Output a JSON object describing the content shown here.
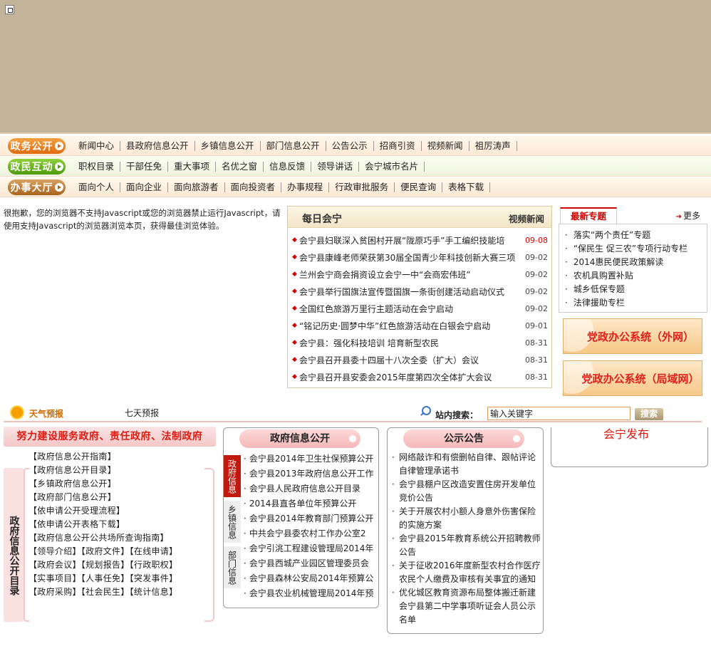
{
  "nav": [
    {
      "badge": "政务公开",
      "links": [
        "新闻中心",
        "县政府信息公开",
        "乡镇信息公开",
        "部门信息公开",
        "公告公示",
        "招商引资",
        "视频新闻",
        "祖厉涛声"
      ]
    },
    {
      "badge": "政民互动",
      "links": [
        "职权目录",
        "干部任免",
        "重大事项",
        "名优之窗",
        "信息反馈",
        "领导讲话",
        "会宁城市名片"
      ]
    },
    {
      "badge": "办事大厅",
      "links": [
        "面向个人",
        "面向企业",
        "面向旅游者",
        "面向投资者",
        "办事规程",
        "行政审批服务",
        "便民查询",
        "表格下载"
      ]
    }
  ],
  "noscript_message": "很抱歉，您的浏览器不支持Javascript或您的浏览器禁止运行Javascript，请使用支持Javascript的浏览器浏览本页，获得最佳浏览体验。",
  "news": {
    "title": "每日会宁",
    "video_label": "视频新闻",
    "items": [
      {
        "title": "会宁县妇联深入贫困村开展“陇原巧手”手工编织技能培",
        "date": "09-08"
      },
      {
        "title": "会宁县康峰老师荣获第30届全国青少年科技创新大赛三项",
        "date": "09-02"
      },
      {
        "title": "兰州会宁商会捐资设立会宁一中“会商宏伟班”",
        "date": "09-02"
      },
      {
        "title": "会宁县举行国旗法宣传暨国旗一条街创建活动启动仪式",
        "date": "09-02"
      },
      {
        "title": "全国红色旅游万里行主题活动在会宁启动",
        "date": "09-02"
      },
      {
        "title": "“铭记历史·圆梦中华”红色旅游活动在白银会宁启动",
        "date": "09-01"
      },
      {
        "title": "会宁县：强化科技培训  培育新型农民",
        "date": "08-31"
      },
      {
        "title": "会宁县召开县委十四届十八次全委（扩大）会议",
        "date": "08-31"
      },
      {
        "title": "会宁县召开县安委会2015年度第四次全体扩大会议",
        "date": "08-31"
      }
    ]
  },
  "special": {
    "tab": "最新专题",
    "more": "更多",
    "items": [
      "落实“两个责任”专题",
      "“保民生 促三农”专项行动专栏",
      "2014惠民便民政策解读",
      "农机具购置补贴",
      "城乡低保专题",
      "法律援助专栏"
    ]
  },
  "office_buttons": {
    "extranet": "党政办公系统（外网）",
    "intranet": "党政办公系统（局域网）"
  },
  "weather": {
    "label": "天气预报",
    "forecast": "七天预报"
  },
  "search": {
    "label": "站内搜索：",
    "value": "输入关键字",
    "button": "搜索"
  },
  "service": {
    "slogan": "努力建设服务政府、责任政府、法制政府",
    "catalog_label": "政府信息公开目录",
    "catalog_items": [
      "【政府信息公开指南】",
      "【政府信息公开目录】",
      "【乡镇政府信息公开】",
      "【政府部门信息公开】",
      "【依申请公开受理流程】",
      "【依申请公开表格下载】",
      "【政府信息公开公共场所查询指南】",
      "【领导介绍】【政府文件】【在线申请】",
      "【政府会议】【规划报告】【行政职权】",
      "【实事项目】【人事任免】【突发事件】",
      "【政府采购】【社会民生】【统计信息】"
    ]
  },
  "info_panel": {
    "title": "政府信息公开",
    "side_tabs": [
      "政府信息",
      "乡镇信息",
      "部门信息"
    ],
    "items": [
      "会宁县2014年卫生社保预算公开",
      "会宁县2013年政府信息公开工作",
      "会宁县人民政府信息公开目录",
      "2014县直各单位年预算公开",
      "会宁县2014年教育部门预算公开",
      "中共会宁县委农村工作办公室2",
      "会宁引洮工程建设管理局2014年",
      "会宁县西城产业园区管理委员会",
      "会宁县森林公安局2014年预算公",
      "会宁县农业机械管理局2014年预"
    ]
  },
  "notice_panel": {
    "title": "公示公告",
    "items": [
      "网络敲诈和有偿删帖自律、跟帖评论自律管理承诺书",
      "会宁县棚户区改造安置住房开发单位竞价公告",
      "关于开展农村小额人身意外伤害保险的实施方案",
      "会宁县2015年教育系统公开招聘教师公告",
      "关于征收2016年度新型农村合作医疗农民个人缴费及审核有关事宜的通知",
      "优化城区教育资源布局整体搬迁新建会宁县第二中学事项听证会人员公示名单"
    ]
  },
  "release": {
    "title": "会宁发布"
  }
}
